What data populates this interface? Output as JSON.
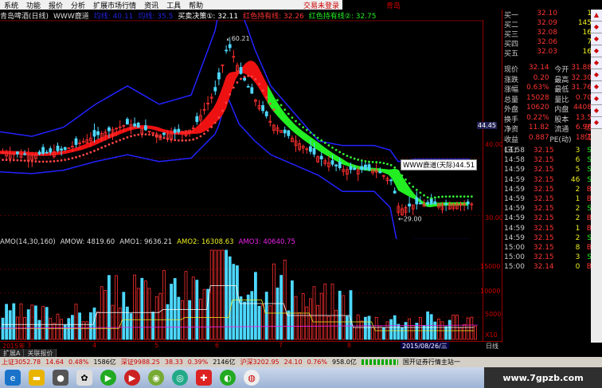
{
  "menu": {
    "items": [
      "系统",
      "功能",
      "报价",
      "分析",
      "扩展市场行情",
      "资讯",
      "工具",
      "帮助"
    ],
    "right_link": "交易未登录",
    "right_link2": "青岛"
  },
  "info_bar": {
    "stock": "青岛啤酒(日线)",
    "indicator": "WWW鹿道",
    "ma_a": "均线: 40.11",
    "ma_b": "均线: 35.5",
    "trade": "买卖决策①: 32.11",
    "red_band": "红色持有线: 32.26",
    "green_band": "红色持有线②: 32.75"
  },
  "main_chart": {
    "price_labels": [
      "60.21",
      "40.00",
      "30.00",
      "44.45",
      "29.00"
    ],
    "callout": "WWW鹿道(天际)44.51"
  },
  "volume_header": {
    "amo": "AMO(14,30,160)",
    "amow": "AMOW: 4819.60",
    "amo1": "AMO1: 9636.21",
    "amo2": "AMO2: 16308.63",
    "amo3": "AMO3: 40640.75"
  },
  "volume_axis": [
    "15000",
    "10000",
    "5000",
    "X10"
  ],
  "time_bar": {
    "year": "2015年",
    "m3": "3",
    "m4": "4",
    "m5": "5",
    "m6": "6",
    "m7": "7",
    "m8": "8",
    "date": "2015/08/26/三",
    "period": "日线"
  },
  "tabs": [
    "扩展A",
    "关联报价"
  ],
  "quote_top": [
    {
      "label": "买一",
      "price": "32.10",
      "vol": "1"
    },
    {
      "label": "买二",
      "price": "32.09",
      "vol": "145"
    },
    {
      "label": "买三",
      "price": "32.08",
      "vol": "16"
    },
    {
      "label": "买四",
      "price": "32.06",
      "vol": "7"
    },
    {
      "label": "买五",
      "price": "32.03",
      "vol": "16"
    }
  ],
  "quote_stats": [
    {
      "l1": "现价",
      "v1": "32.14",
      "l2": "今开",
      "v2": "31.88"
    },
    {
      "l1": "涨跌",
      "v1": "0.20",
      "l2": "最高",
      "v2": "32.30"
    },
    {
      "l1": "涨幅",
      "v1": "0.63%",
      "l2": "最低",
      "v2": "31.76"
    },
    {
      "l1": "总量",
      "v1": "15028",
      "l2": "量比",
      "v2": "0.70"
    },
    {
      "l1": "外盘",
      "v1": "10620",
      "l2": "内盘",
      "v2": "4408"
    },
    {
      "l1": "换手",
      "v1": "0.22%",
      "l2": "股本",
      "v2": "13.5亿"
    },
    {
      "l1": "净资",
      "v1": "11.82",
      "l2": "流通",
      "v2": "6.96亿"
    },
    {
      "l1": "收益(三)",
      "v1": "0.887",
      "l2": "PE(动)",
      "v2": "18.1"
    }
  ],
  "ticks": [
    {
      "t": "14:58",
      "p": "32.15",
      "v": "3",
      "d": "S"
    },
    {
      "t": "14:58",
      "p": "32.15",
      "v": "6",
      "d": "S"
    },
    {
      "t": "14:59",
      "p": "32.15",
      "v": "5",
      "d": "S"
    },
    {
      "t": "14:59",
      "p": "32.15",
      "v": "46",
      "d": "S"
    },
    {
      "t": "14:59",
      "p": "32.15",
      "v": "2",
      "d": "B"
    },
    {
      "t": "14:59",
      "p": "32.15",
      "v": "1",
      "d": "B"
    },
    {
      "t": "14:59",
      "p": "32.15",
      "v": "2",
      "d": "S"
    },
    {
      "t": "14:59",
      "p": "32.15",
      "v": "2",
      "d": "B"
    },
    {
      "t": "14:59",
      "p": "32.15",
      "v": "1",
      "d": "B"
    },
    {
      "t": "14:59",
      "p": "32.15",
      "v": "2",
      "d": "S"
    },
    {
      "t": "15:00",
      "p": "32.15",
      "v": "8",
      "d": "B"
    },
    {
      "t": "15:00",
      "p": "32.15",
      "v": "3",
      "d": "S"
    },
    {
      "t": "15:00",
      "p": "32.14",
      "v": "0",
      "d": "B"
    }
  ],
  "status_bar": {
    "sh": "上证3052.78",
    "sh_chg": "14.64",
    "sh_pct": "0.48%",
    "sh_amt": "1586亿",
    "sz": "深证9988.25",
    "sz_chg": "38.33",
    "sz_pct": "0.39%",
    "sz_amt": "2146亿",
    "hs": "沪深3202.95",
    "hs_chg": "24.10",
    "hs_pct": "0.76%",
    "hs_amt": "958.0亿",
    "site": "国开证券行情主站一"
  },
  "watermark": "www.7gpzb.com",
  "colors": {
    "up": "#ff3030",
    "down": "#4dd8ff",
    "green_band": "#22ee22",
    "red_band": "#ee1111",
    "blue_channel": "#2222ff"
  }
}
